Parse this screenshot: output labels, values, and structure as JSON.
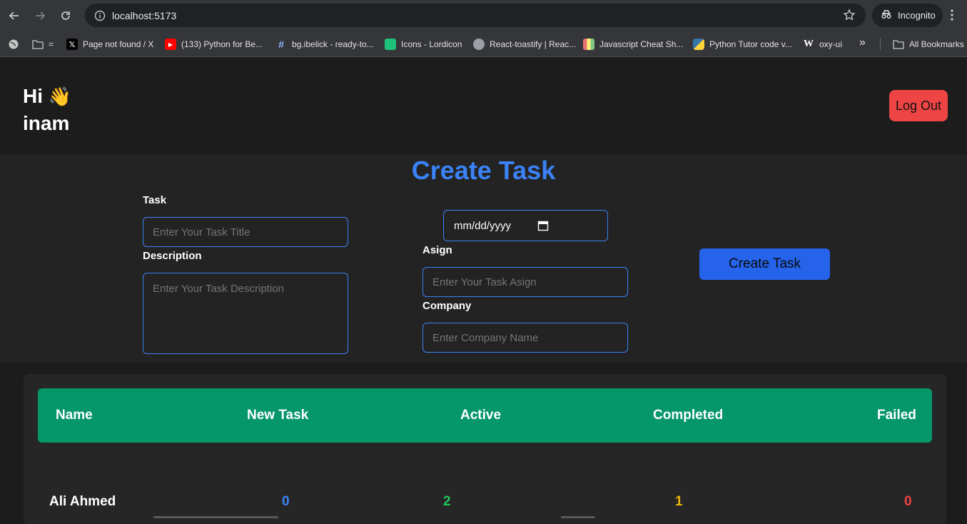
{
  "browser": {
    "url": "localhost:5173",
    "incognito_label": "Incognito",
    "bookmarks": [
      {
        "label": "Page not found / X",
        "icon": "x-icon"
      },
      {
        "label": "(133) Python for Be...",
        "icon": "youtube-icon"
      },
      {
        "label": "bg.ibelick - ready-to...",
        "icon": "hash-icon"
      },
      {
        "label": "Icons - Lordicon",
        "icon": "lordicon-icon"
      },
      {
        "label": "React-toastify | Reac...",
        "icon": "toastify-icon"
      },
      {
        "label": "Javascript Cheat Sh...",
        "icon": "cheatsheet-icon"
      },
      {
        "label": "Python Tutor code v...",
        "icon": "python-icon"
      },
      {
        "label": "oxy-ui",
        "icon": "oxy-icon"
      }
    ],
    "folder_label": "=",
    "overflow_label": "»",
    "all_bookmarks_label": "All Bookmarks"
  },
  "header": {
    "greeting": "Hi",
    "wave_emoji": "👋",
    "username": "inam",
    "logout_label": "Log Out"
  },
  "form": {
    "title": "Create Task",
    "task_label": "Task",
    "task_placeholder": "Enter Your Task Title",
    "description_label": "Description",
    "description_placeholder": "Enter Your Task Description",
    "date_value": "mm/dd/yyyy",
    "assign_label": "Asign",
    "assign_placeholder": "Enter Your Task Asign",
    "company_label": "Company",
    "company_placeholder": "Enter Company Name",
    "submit_label": "Create Task"
  },
  "table": {
    "headers": [
      "Name",
      "New Task",
      "Active",
      "Completed",
      "Failed"
    ],
    "rows": [
      {
        "name": "Ali Ahmed",
        "new_task": "0",
        "active": "2",
        "completed": "1",
        "failed": "0"
      }
    ]
  },
  "colors": {
    "accent_blue": "#3b82f6",
    "header_green": "#059669",
    "logout_red": "#ef4444",
    "new_task": "#3b82f6",
    "active": "#22c55e",
    "completed": "#eab308",
    "failed": "#ef4444"
  }
}
